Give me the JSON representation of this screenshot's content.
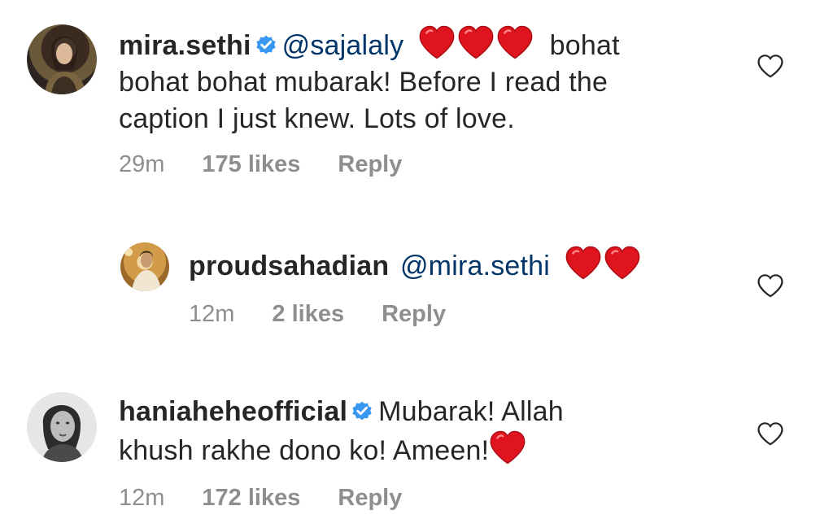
{
  "comments": [
    {
      "username": "mira.sethi",
      "verified": true,
      "mention": "@sajalaly",
      "hearts": 3,
      "text_line1_end": "bohat",
      "text_line2": "bohat bohat mubarak! Before I read the",
      "text_line3": "caption I just knew. Lots of love.",
      "time": "29m",
      "likes": "175 likes",
      "reply": "Reply"
    },
    {
      "username": "proudsahadian",
      "verified": false,
      "mention": "@mira.sethi",
      "hearts": 2,
      "time": "12m",
      "likes": "2 likes",
      "reply": "Reply"
    },
    {
      "username": "haniaheheofficial",
      "verified": true,
      "text_line1_end": "Mubarak! Allah",
      "text_line2": "khush rakhe dono ko! Ameen!",
      "hearts": 1,
      "time": "12m",
      "likes": "172 likes",
      "reply": "Reply"
    }
  ],
  "colors": {
    "text": "#262626",
    "mention": "#003569",
    "meta": "#8e8e8e",
    "heart": "#e0141e",
    "verified": "#3897f0"
  },
  "icons": {
    "verified": "verified-badge-icon",
    "heart_emoji": "red-heart-emoji-icon",
    "like": "heart-outline-icon"
  }
}
